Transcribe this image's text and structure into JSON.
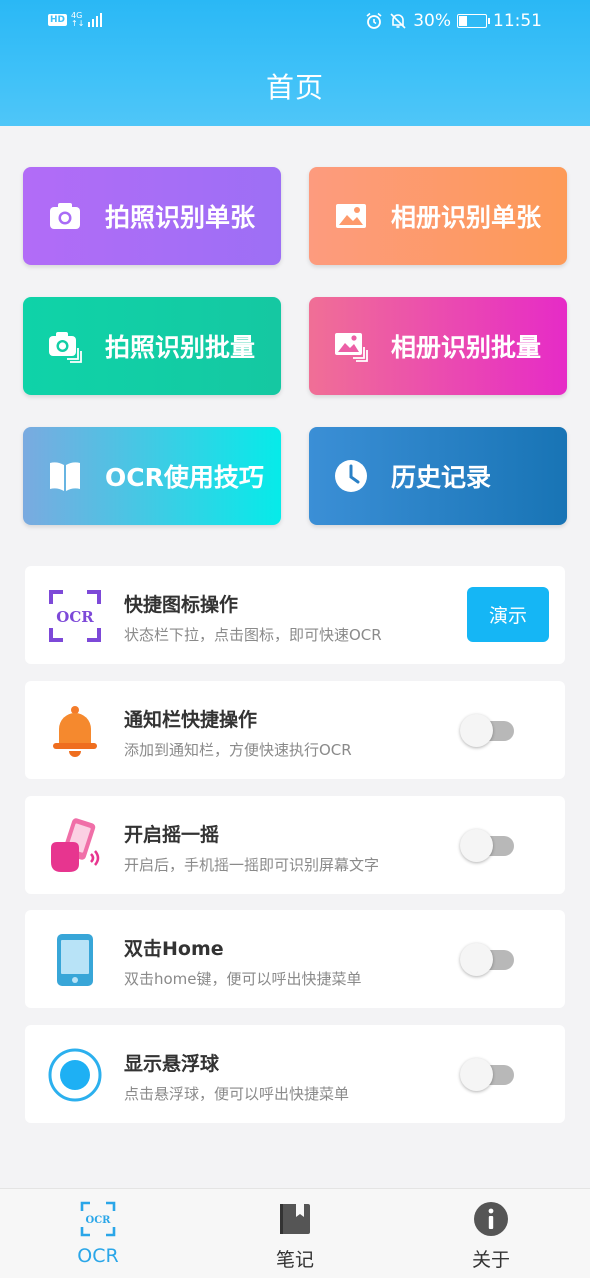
{
  "status_bar": {
    "hd": "HD",
    "network": "4G",
    "network_sub": "↑↓",
    "battery": "30%",
    "time": "11:51"
  },
  "header": {
    "title": "首页"
  },
  "tiles": [
    {
      "label": "拍照识别单张",
      "icon": "camera-icon",
      "colors": [
        "#b26cf7",
        "#9d6ff5"
      ]
    },
    {
      "label": "相册识别单张",
      "icon": "image-icon",
      "colors": [
        "#fd9b7e",
        "#fd9a57"
      ]
    },
    {
      "label": "拍照识别批量",
      "icon": "camera-batch-icon",
      "colors": [
        "#0fd3a8",
        "#15c8a2"
      ]
    },
    {
      "label": "相册识别批量",
      "icon": "image-batch-icon",
      "colors": [
        "#f06f96",
        "#e62bc7"
      ]
    },
    {
      "label": "OCR使用技巧",
      "icon": "book-icon",
      "colors": [
        "#7aaae0",
        "#06ebe9"
      ]
    },
    {
      "label": "历史记录",
      "icon": "clock-icon",
      "colors": [
        "#3b8fd6",
        "#1874b5"
      ]
    }
  ],
  "features": [
    {
      "title": "快捷图标操作",
      "subtitle": "状态栏下拉，点击图标，即可快速OCR",
      "icon": "ocr-scan-icon",
      "action": "演示"
    },
    {
      "title": "通知栏快捷操作",
      "subtitle": "添加到通知栏，方便快速执行OCR",
      "icon": "bell-icon",
      "toggle": false
    },
    {
      "title": "开启摇一摇",
      "subtitle": "开启后，手机摇一摇即可识别屏幕文字",
      "icon": "shake-phone-icon",
      "toggle": false
    },
    {
      "title": "双击Home",
      "subtitle": "双击home键，便可以呼出快捷菜单",
      "icon": "phone-icon",
      "toggle": false
    },
    {
      "title": "显示悬浮球",
      "subtitle": "点击悬浮球，便可以呼出快捷菜单",
      "icon": "float-ball-icon",
      "toggle": false
    }
  ],
  "tabs": [
    {
      "label": "OCR",
      "icon": "ocr-scan-icon",
      "active": true
    },
    {
      "label": "笔记",
      "icon": "notebook-icon",
      "active": false
    },
    {
      "label": "关于",
      "icon": "info-icon",
      "active": false
    }
  ],
  "ocr_icon_text": "OCR"
}
